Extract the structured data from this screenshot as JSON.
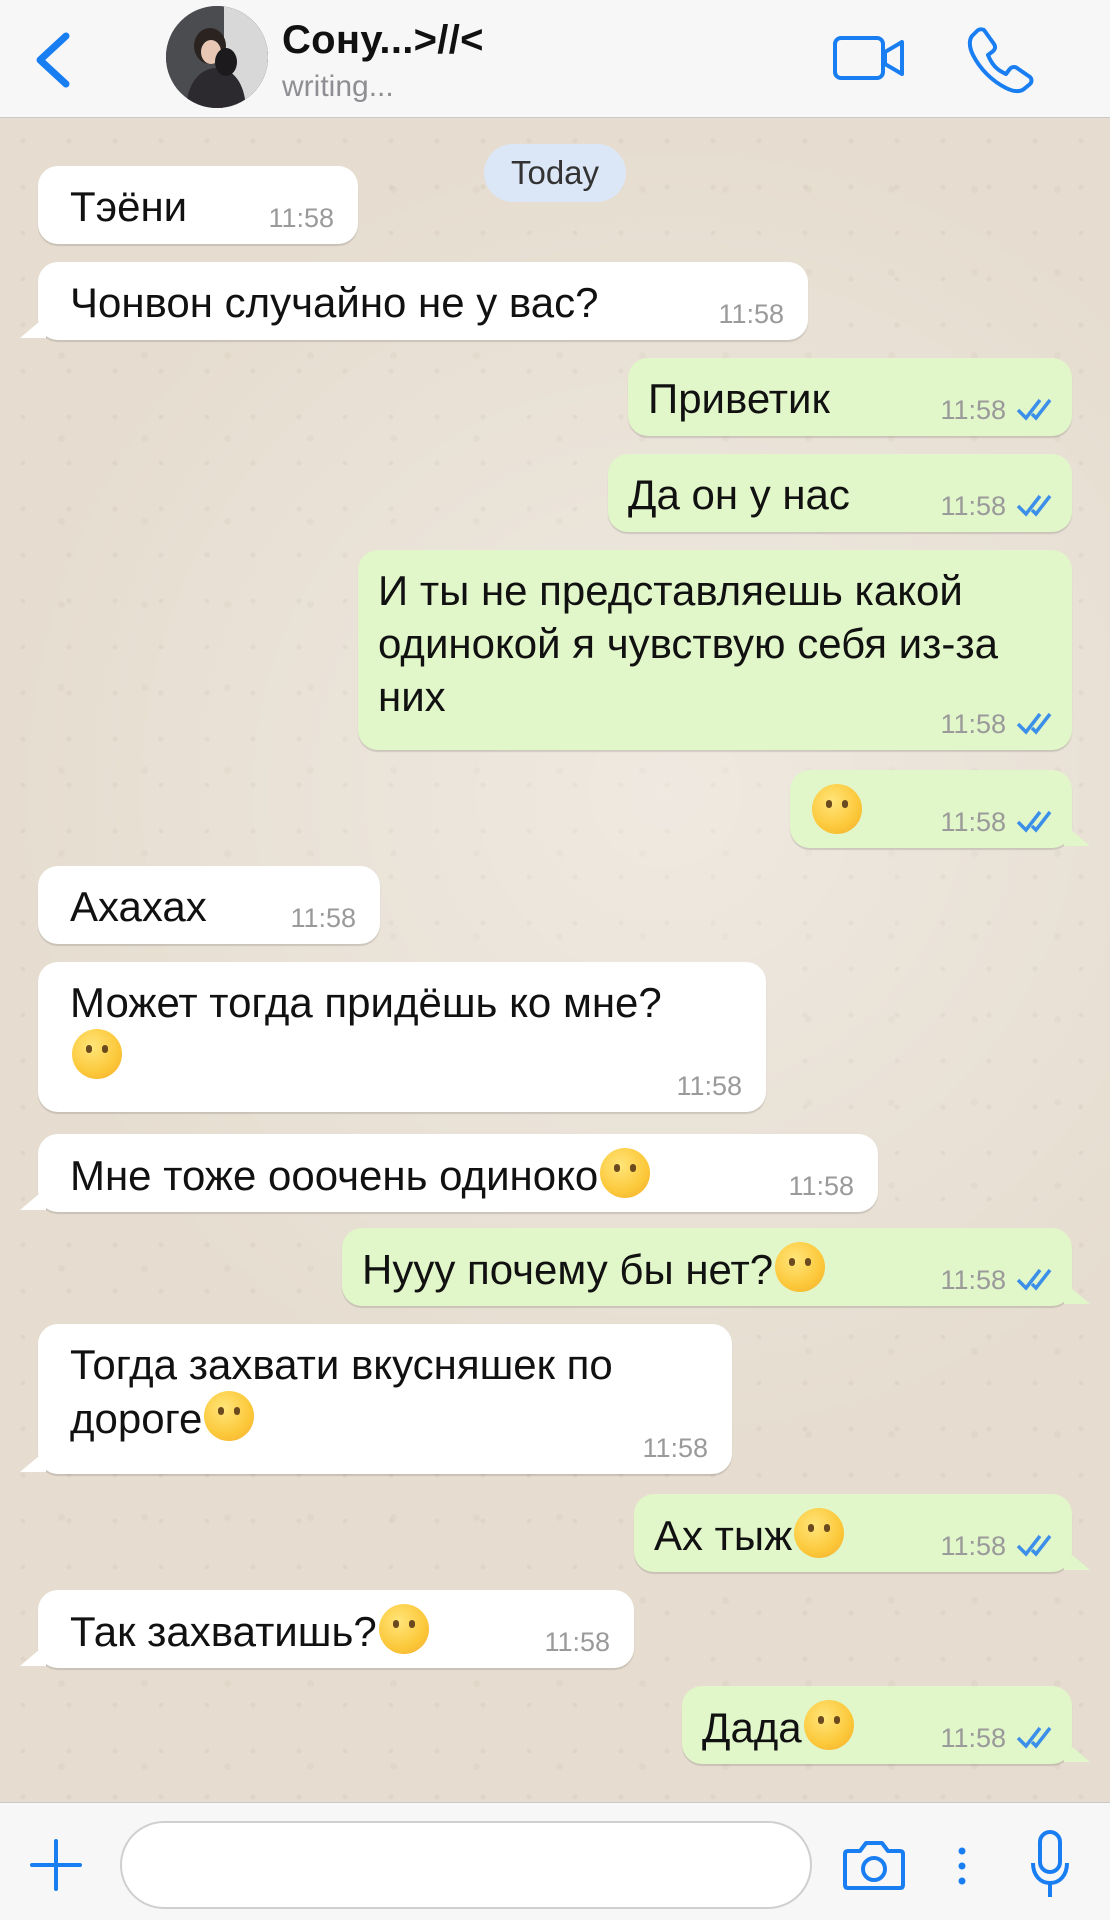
{
  "header": {
    "contact_name": "Сону...>//<",
    "contact_status": "writing..."
  },
  "chat": {
    "date_label": "Today",
    "messages": [
      {
        "direction": "in",
        "text": "Тэёни",
        "time": "11:58"
      },
      {
        "direction": "in",
        "text": "Чонвон случайно не у вас?",
        "time": "11:58"
      },
      {
        "direction": "out",
        "text": "Приветик",
        "time": "11:58",
        "status": "read"
      },
      {
        "direction": "out",
        "text": "Да он у нас",
        "time": "11:58",
        "status": "read"
      },
      {
        "direction": "out",
        "text": "И ты не представляешь какой одинокой я чувствую себя из-за них",
        "time": "11:58",
        "status": "read"
      },
      {
        "direction": "out",
        "text": "",
        "emoji": "crying-face-emoji",
        "time": "11:58",
        "status": "read"
      },
      {
        "direction": "in",
        "text": "Ахахах",
        "time": "11:58"
      },
      {
        "direction": "in",
        "text": "Может тогда придёшь ко мне?",
        "emoji": "winking-face-emoji",
        "time": "11:58"
      },
      {
        "direction": "in",
        "text": "Мне тоже ооочень одиноко",
        "emoji": "tired-face-emoji",
        "time": "11:58"
      },
      {
        "direction": "out",
        "text": "Нууу почему бы нет?",
        "emoji": "smirking-face-emoji",
        "time": "11:58",
        "status": "read"
      },
      {
        "direction": "in",
        "text": "Тогда захвати вкусняшек по дороге",
        "emoji": "slightly-smiling-face-emoji",
        "time": "11:58"
      },
      {
        "direction": "out",
        "text": "Ах тыж",
        "emoji": "expressionless-face-emoji",
        "time": "11:58",
        "status": "read"
      },
      {
        "direction": "in",
        "text": "Так захватишь?",
        "emoji": "hugging-face-emoji",
        "time": "11:58"
      },
      {
        "direction": "out",
        "text": "Дада",
        "emoji": "eye-roll-face-emoji",
        "time": "11:58",
        "status": "read"
      }
    ]
  },
  "input": {
    "placeholder": "",
    "value": ""
  },
  "icons": {
    "back": "chevron-left-icon",
    "video": "video-camera-icon",
    "call": "phone-icon",
    "add": "plus-icon",
    "camera": "camera-icon",
    "more": "more-vertical-icon",
    "mic": "microphone-icon",
    "read": "double-check-icon"
  },
  "colors": {
    "accent": "#1a7ef3",
    "incoming_bubble": "#ffffff",
    "outgoing_bubble": "#e1f6c9",
    "read_ticks": "#3b8fe8",
    "date_pill": "#dbe6f7"
  }
}
